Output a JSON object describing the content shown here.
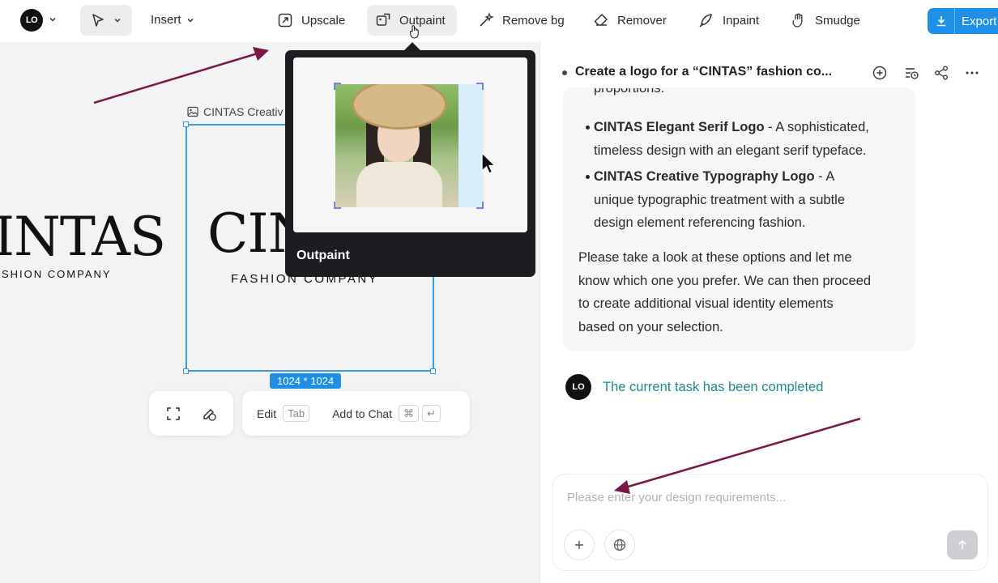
{
  "toolbar": {
    "logo_text": "LO",
    "insert_label": "Insert",
    "tools": [
      {
        "label": "Upscale",
        "icon": "upscale-icon"
      },
      {
        "label": "Outpaint",
        "icon": "outpaint-icon"
      },
      {
        "label": "Remove bg",
        "icon": "remove-bg-icon"
      },
      {
        "label": "Remover",
        "icon": "eraser-icon"
      },
      {
        "label": "Inpaint",
        "icon": "inpaint-icon"
      },
      {
        "label": "Smudge",
        "icon": "smudge-icon"
      }
    ],
    "export_label": "Export",
    "accent": "#1e90e8"
  },
  "canvas": {
    "left_logo_big": "INTAS",
    "left_logo_sub": "SHION COMPANY",
    "frame_label": "CINTAS Creativ",
    "main_logo_big": "CIN",
    "main_logo_sub": "FASHION COMPANY",
    "size_badge": "1024 * 1024",
    "edit_label": "Edit",
    "edit_key": "Tab",
    "add_to_chat_label": "Add to Chat",
    "add_to_chat_key1": "⌘",
    "add_to_chat_key2": "↵",
    "selection_color": "#3a9be8"
  },
  "popover": {
    "label": "Outpaint"
  },
  "chat": {
    "title": "Create a logo for a “CINTAS” fashion co...",
    "partial_line": "proportions.",
    "items": [
      {
        "name": "CINTAS Elegant Serif Logo",
        "line1": " - A sophisticated,",
        "line2": "timeless design with an elegant serif typeface."
      },
      {
        "name": "CINTAS Creative Typography Logo",
        "line1": " - A",
        "line2": "unique typographic treatment with a subtle",
        "line3": "design element referencing fashion."
      }
    ],
    "para": [
      "Please take a look at these options and let me",
      "know which one you prefer. We can then proceed",
      "to create additional visual identity elements",
      "based on your selection."
    ],
    "done_text": "The current task has been completed",
    "done_color": "#1f8a8a",
    "composer_placeholder": "Please enter your design requirements..."
  },
  "annotation_color": "#7a1648"
}
